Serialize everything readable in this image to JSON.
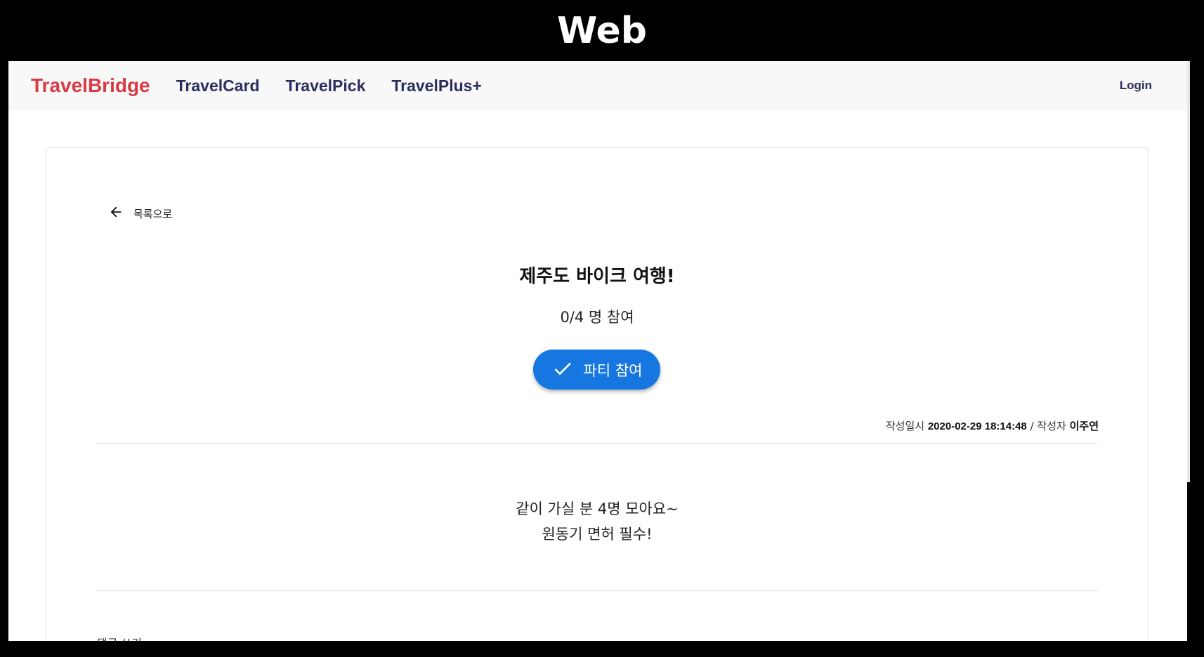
{
  "banner": {
    "title": "Web"
  },
  "navbar": {
    "brand": "TravelBridge",
    "links": [
      "TravelCard",
      "TravelPick",
      "TravelPlus+"
    ],
    "login": "Login"
  },
  "post": {
    "back_label": "목록으로",
    "title": "제주도 바이크 여행!",
    "participants": "0/4 명 참여",
    "join_button": "파티 참여",
    "meta": {
      "created_label": "작성일시",
      "created_value": "2020-02-29 18:14:48",
      "separator": "/",
      "author_label": "작성자",
      "author_value": "이주연"
    },
    "content_lines": [
      "같이 가실 분 4명 모아요~",
      "원동기 면허 필수!"
    ],
    "comment_label": "댓글 쓰기"
  },
  "colors": {
    "brand": "#d93b45",
    "nav_text": "#2b2d5e",
    "primary_button": "#1677e0"
  },
  "icons": {
    "back": "arrow-left-icon",
    "join": "check-icon"
  }
}
